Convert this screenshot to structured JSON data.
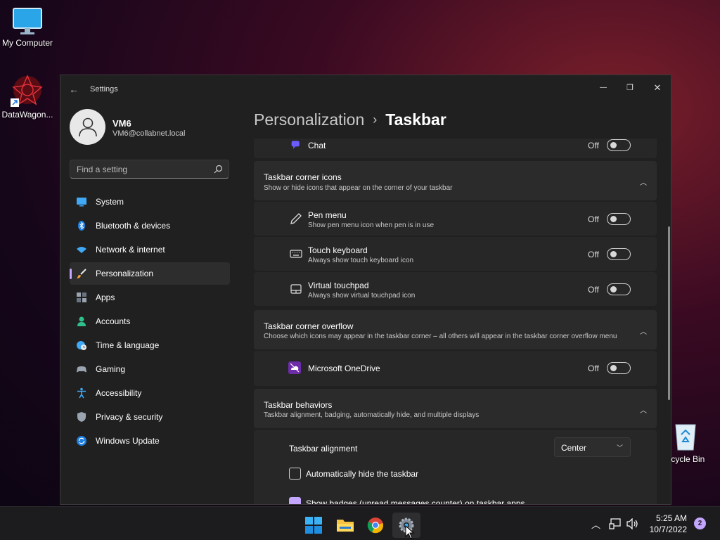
{
  "desktop": {
    "icons": [
      {
        "label": "My Computer"
      },
      {
        "label": "DataWagon..."
      },
      {
        "label": "ecycle Bin"
      }
    ]
  },
  "window": {
    "title": "Settings",
    "controls": {
      "minimize": "—",
      "maximize": "❐",
      "close": "✕"
    }
  },
  "profile": {
    "name": "VM6",
    "email": "VM6@collabnet.local"
  },
  "search": {
    "placeholder": "Find a setting"
  },
  "nav": {
    "items": [
      {
        "label": "System",
        "icon": "monitor-icon"
      },
      {
        "label": "Bluetooth & devices",
        "icon": "bluetooth-icon"
      },
      {
        "label": "Network & internet",
        "icon": "wifi-icon"
      },
      {
        "label": "Personalization",
        "icon": "brush-icon",
        "active": true
      },
      {
        "label": "Apps",
        "icon": "apps-icon"
      },
      {
        "label": "Accounts",
        "icon": "person-icon"
      },
      {
        "label": "Time & language",
        "icon": "globe-clock-icon"
      },
      {
        "label": "Gaming",
        "icon": "controller-icon"
      },
      {
        "label": "Accessibility",
        "icon": "accessibility-icon"
      },
      {
        "label": "Privacy & security",
        "icon": "shield-icon"
      },
      {
        "label": "Windows Update",
        "icon": "update-icon"
      }
    ]
  },
  "breadcrumb": {
    "parent": "Personalization",
    "separator": "›",
    "current": "Taskbar"
  },
  "main": {
    "chat": {
      "label": "Chat",
      "state": "Off"
    },
    "corner_icons": {
      "title": "Taskbar corner icons",
      "desc": "Show or hide icons that appear on the corner of your taskbar",
      "rows": [
        {
          "title": "Pen menu",
          "desc": "Show pen menu icon when pen is in use",
          "state": "Off"
        },
        {
          "title": "Touch keyboard",
          "desc": "Always show touch keyboard icon",
          "state": "Off"
        },
        {
          "title": "Virtual touchpad",
          "desc": "Always show virtual touchpad icon",
          "state": "Off"
        }
      ]
    },
    "corner_overflow": {
      "title": "Taskbar corner overflow",
      "desc": "Choose which icons may appear in the taskbar corner – all others will appear in the taskbar corner overflow menu",
      "rows": [
        {
          "title": "Microsoft OneDrive",
          "state": "Off"
        }
      ]
    },
    "behaviors": {
      "title": "Taskbar behaviors",
      "desc": "Taskbar alignment, badging, automatically hide, and multiple displays",
      "alignment_label": "Taskbar alignment",
      "alignment_value": "Center",
      "autohide_label": "Automatically hide the taskbar",
      "badges_label": "Show badges (unread messages counter) on taskbar apps"
    }
  },
  "taskbar": {
    "clock_time": "5:25 AM",
    "clock_date": "10/7/2022",
    "notification_count": "2"
  },
  "colors": {
    "accent": "#c4a6ff",
    "window_bg": "#202020",
    "card_bg": "#2b2b2b"
  }
}
